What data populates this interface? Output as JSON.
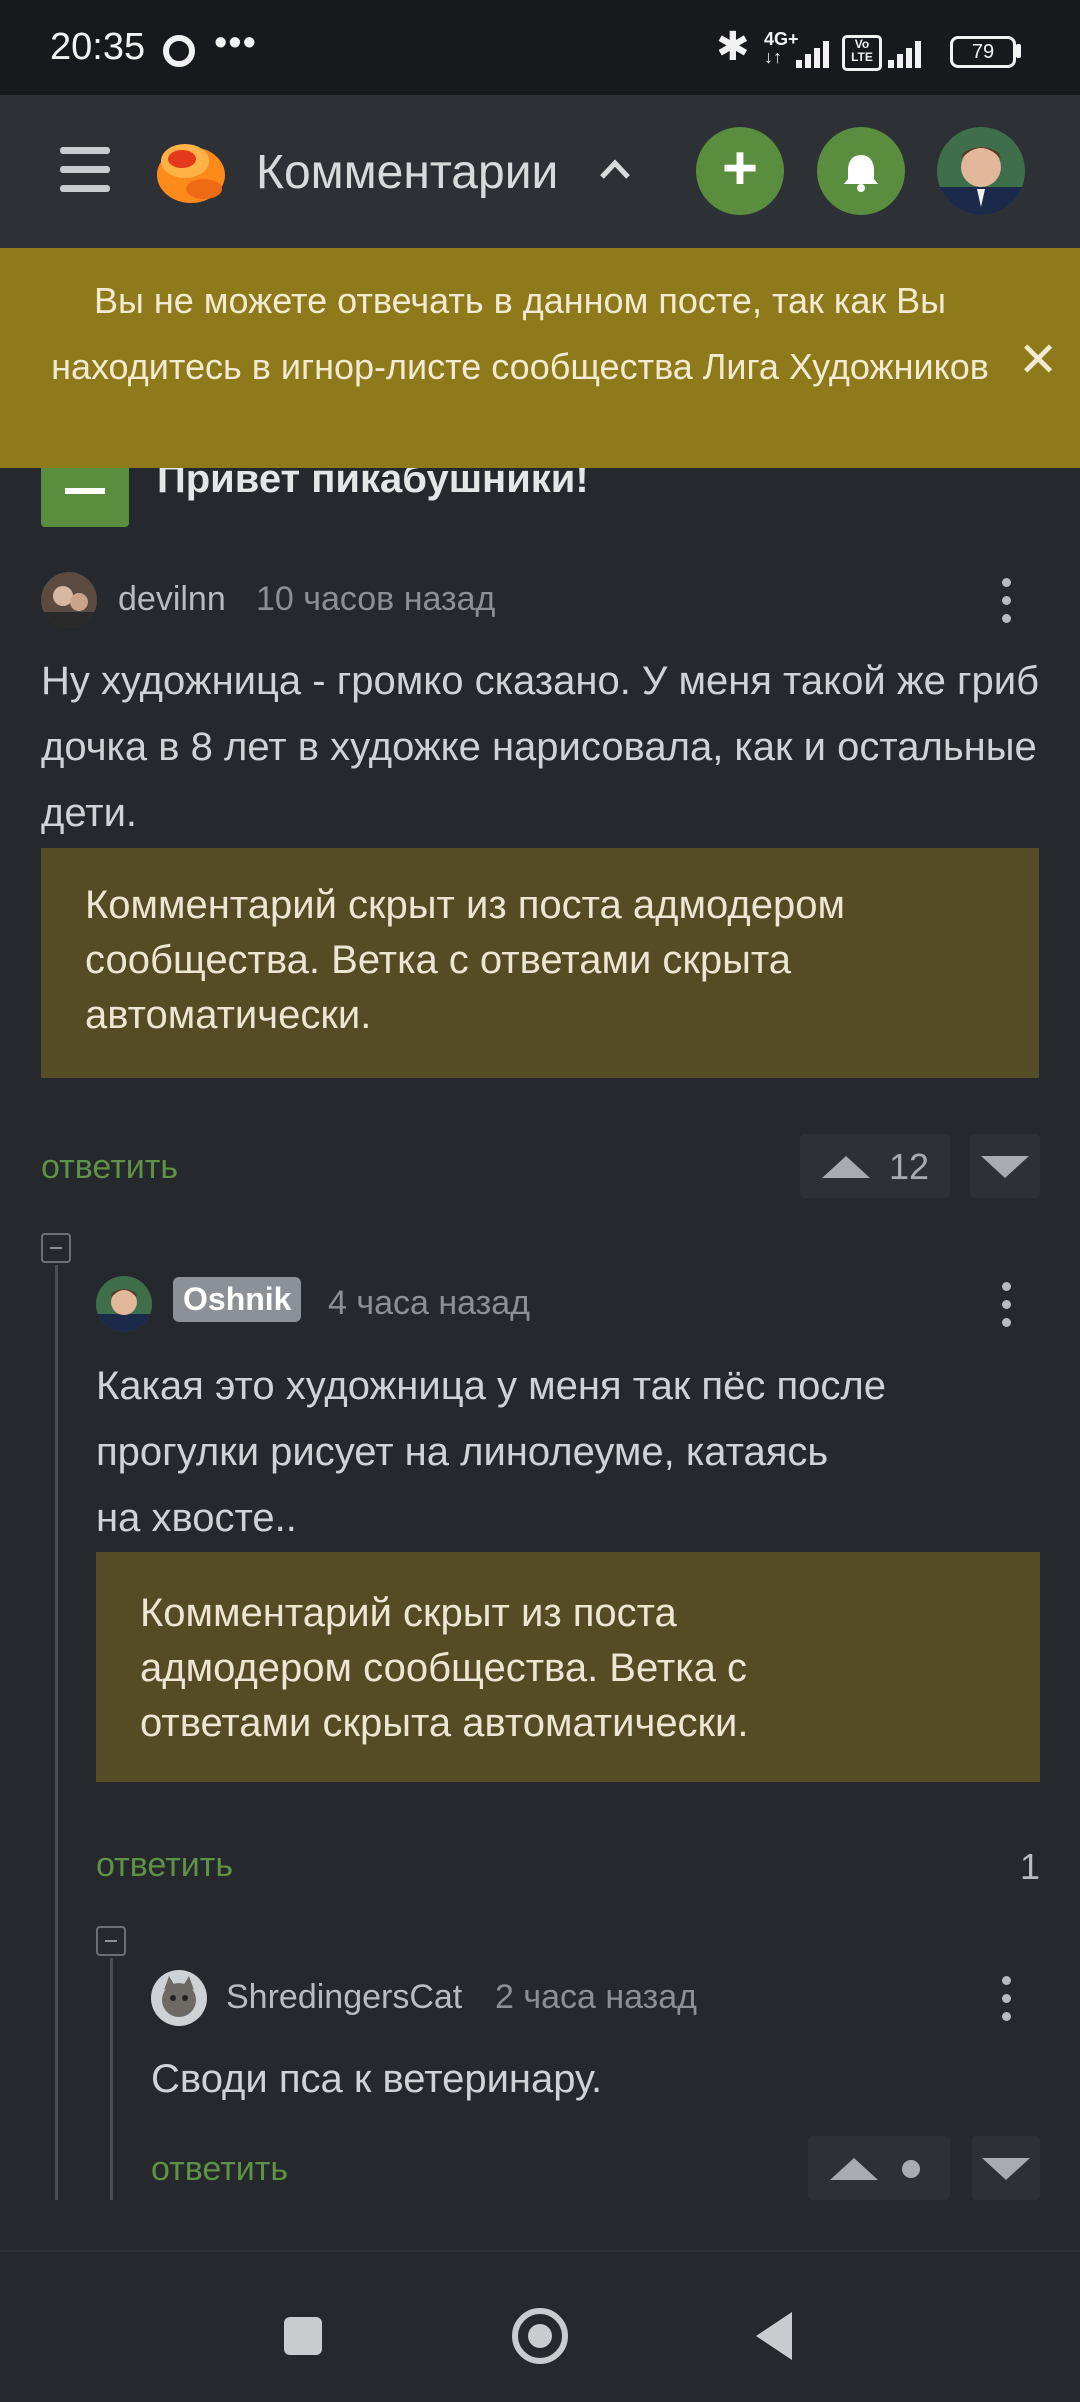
{
  "status_bar": {
    "time": "20:35",
    "dots": "•••",
    "network_line1": "4G+",
    "network_line2": "↓↑",
    "volte": "Vo LTE",
    "battery": "79"
  },
  "header": {
    "title": "Комментарии",
    "caret": "^",
    "add_label": "+"
  },
  "banner": {
    "text": "Вы не можете отвечать в данном посте, так как Вы находитесь в игнор-листе сообщества Лига Художников",
    "close": "✕"
  },
  "post": {
    "title": "Привет пикабушники!"
  },
  "comments": [
    {
      "user": "devilnn",
      "time": "10 часов назад",
      "text": "Ну художница - громко сказано. У меня такой же гриб дочка в 8 лет в художке нарисовала, как и остальные дети.",
      "hidden_notice": "Комментарий скрыт из поста адмодером сообщества. Ветка с ответами скрыта автоматически.",
      "reply": "ответить",
      "rating": "12"
    },
    {
      "user": "Oshnik",
      "time": "4 часа назад",
      "text_lines": [
        "Какая это художница у меня так пёс после",
        "прогулки рисует на линолеуме, катаясь",
        "на хвосте.."
      ],
      "hidden_notice": "Комментарий скрыт из поста адмодером сообщества. Ветка с ответами скрыта автоматически.",
      "reply": "ответить",
      "replies_count": "1"
    },
    {
      "user": "ShredingersCat",
      "time": "2 часа назад",
      "text": "Своди пса к ветеринару.",
      "reply": "ответить"
    }
  ],
  "colors": {
    "accent_green": "#5b8d3f",
    "banner": "#8e7a1a",
    "hidden_box": "#554b24",
    "background": "#25282d"
  },
  "icons": [
    "menu-icon",
    "pikabu-logo-icon",
    "plus-icon",
    "bell-icon",
    "close-icon",
    "kebab-icon",
    "arrow-up-icon",
    "arrow-down-icon",
    "collapse-icon"
  ]
}
